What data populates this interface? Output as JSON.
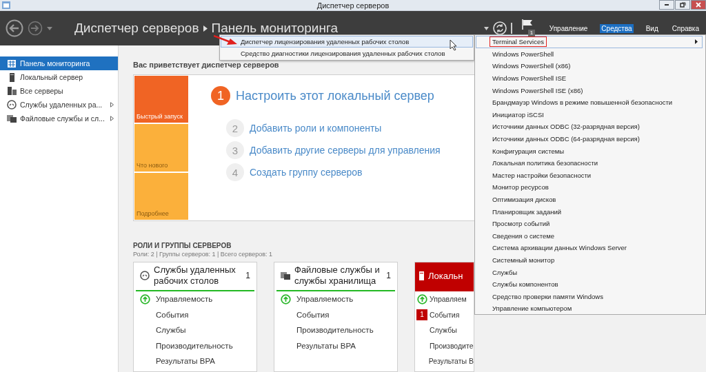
{
  "window": {
    "title": "Диспетчер серверов"
  },
  "header": {
    "breadcrumb": [
      "Диспетчер серверов",
      "Панель мониторинга"
    ],
    "flag_badge": "1",
    "menu": [
      {
        "label": "Управление",
        "selected": false
      },
      {
        "label": "Средства",
        "selected": true
      },
      {
        "label": "Вид",
        "selected": false
      },
      {
        "label": "Справка",
        "selected": false
      }
    ]
  },
  "sidebar": {
    "items": [
      {
        "label": "Панель мониторинга",
        "selected": true,
        "expandable": false
      },
      {
        "label": "Локальный сервер",
        "selected": false,
        "expandable": false
      },
      {
        "label": "Все серверы",
        "selected": false,
        "expandable": false
      },
      {
        "label": "Службы удаленных ра...",
        "selected": false,
        "expandable": true
      },
      {
        "label": "Файловые службы и сл...",
        "selected": false,
        "expandable": true
      }
    ]
  },
  "welcome": {
    "title": "Вас приветствует диспетчер серверов",
    "tiles": [
      {
        "label": "Быстрый запуск",
        "selected": true
      },
      {
        "label": "Что нового",
        "selected": false
      },
      {
        "label": "Подробнее",
        "selected": false
      }
    ],
    "steps": [
      {
        "number": "1",
        "label": "Настроить этот локальный сервер",
        "kind": "primary"
      },
      {
        "number": "2",
        "label": "Добавить роли и компоненты",
        "kind": "secondary"
      },
      {
        "number": "3",
        "label": "Добавить другие серверы для управления",
        "kind": "secondary"
      },
      {
        "number": "4",
        "label": "Создать группу серверов",
        "kind": "secondary"
      }
    ]
  },
  "roles": {
    "title": "РОЛИ И ГРУППЫ СЕРВЕРОВ",
    "summary": "Роли: 2 | Группы серверов: 1 | Всего серверов: 1",
    "cards": [
      {
        "title": "Службы удаленных рабочих столов",
        "count": "1",
        "alert": false,
        "rows": [
          {
            "label": "Управляемость",
            "kind": "ok"
          },
          {
            "label": "События",
            "kind": "plain"
          },
          {
            "label": "Службы",
            "kind": "plain"
          },
          {
            "label": "Производительность",
            "kind": "plain"
          },
          {
            "label": "Результаты BPA",
            "kind": "plain"
          }
        ]
      },
      {
        "title": "Файловые службы и службы хранилища",
        "count": "1",
        "alert": false,
        "rows": [
          {
            "label": "Управляемость",
            "kind": "ok"
          },
          {
            "label": "События",
            "kind": "plain"
          },
          {
            "label": "Производительность",
            "kind": "plain"
          },
          {
            "label": "Результаты BPA",
            "kind": "plain"
          }
        ]
      },
      {
        "title": "Локальн",
        "alert": true,
        "rows": [
          {
            "label": "Управляем",
            "kind": "ok"
          },
          {
            "label": "События",
            "kind": "count",
            "badge": "1"
          },
          {
            "label": "Службы",
            "kind": "plain"
          },
          {
            "label": "Производите",
            "kind": "plain"
          },
          {
            "label": "Результаты В",
            "kind": "plain"
          }
        ]
      }
    ]
  },
  "submenu": {
    "items": [
      {
        "label": "Диспетчер лицензирования удаленных рабочих столов",
        "selected": true
      },
      {
        "label": "Средство диагностики лицензирования удаленных рабочих столов",
        "selected": false
      }
    ]
  },
  "tools_menu": {
    "items": [
      {
        "label": "Terminal Services",
        "selected": true,
        "has_submenu": true
      },
      {
        "label": "Windows PowerShell",
        "selected": false,
        "has_submenu": false
      },
      {
        "label": "Windows PowerShell (x86)",
        "selected": false,
        "has_submenu": false
      },
      {
        "label": "Windows PowerShell ISE",
        "selected": false,
        "has_submenu": false
      },
      {
        "label": "Windows PowerShell ISE (x86)",
        "selected": false,
        "has_submenu": false
      },
      {
        "label": "Брандмауэр Windows в режиме повышенной безопасности",
        "selected": false,
        "has_submenu": false
      },
      {
        "label": "Инициатор iSCSI",
        "selected": false,
        "has_submenu": false
      },
      {
        "label": "Источники данных ODBC (32-разрядная версия)",
        "selected": false,
        "has_submenu": false
      },
      {
        "label": "Источники данных ODBC (64-разрядная версия)",
        "selected": false,
        "has_submenu": false
      },
      {
        "label": "Конфигурация системы",
        "selected": false,
        "has_submenu": false
      },
      {
        "label": "Локальная политика безопасности",
        "selected": false,
        "has_submenu": false
      },
      {
        "label": "Мастер настройки безопасности",
        "selected": false,
        "has_submenu": false
      },
      {
        "label": "Монитор ресурсов",
        "selected": false,
        "has_submenu": false
      },
      {
        "label": "Оптимизация дисков",
        "selected": false,
        "has_submenu": false
      },
      {
        "label": "Планировщик заданий",
        "selected": false,
        "has_submenu": false
      },
      {
        "label": "Просмотр событий",
        "selected": false,
        "has_submenu": false
      },
      {
        "label": "Сведения о системе",
        "selected": false,
        "has_submenu": false
      },
      {
        "label": "Система архивации данных Windows Server",
        "selected": false,
        "has_submenu": false
      },
      {
        "label": "Системный монитор",
        "selected": false,
        "has_submenu": false
      },
      {
        "label": "Службы",
        "selected": false,
        "has_submenu": false
      },
      {
        "label": "Службы компонентов",
        "selected": false,
        "has_submenu": false
      },
      {
        "label": "Средство проверки памяти Windows",
        "selected": false,
        "has_submenu": false
      },
      {
        "label": "Управление компьютером",
        "selected": false,
        "has_submenu": false
      }
    ]
  }
}
